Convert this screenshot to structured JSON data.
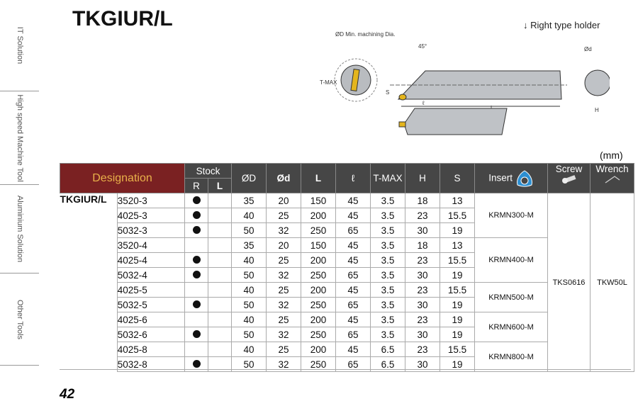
{
  "sidebar": [
    "IT Solution",
    "High speed Machine Tool",
    "Aluminium Solution",
    "Other Tools"
  ],
  "title": "TKGIUR/L",
  "right_type": "↓ Right  type holder",
  "diagram": {
    "min_dia": "ØD Min. machining Dia.",
    "angle": "45°",
    "tmax": "T-MAX",
    "s": "S",
    "l": "ℓ",
    "L": "L",
    "d": "Ød",
    "h": "H"
  },
  "unit": "(mm)",
  "headers": {
    "designation": "Designation",
    "stock": "Stock",
    "r": "R",
    "l_stock": "L",
    "D": "ØD",
    "d": "Ød",
    "L": "L",
    "ell": "ℓ",
    "tmax": "T-MAX",
    "H": "H",
    "S": "S",
    "insert": "Insert",
    "screw": "Screw",
    "wrench": "Wrench"
  },
  "model": "TKGIUR/L",
  "rows": [
    [
      "3520-3",
      true,
      false,
      "35",
      "20",
      "150",
      "45",
      "3.5",
      "18",
      "13"
    ],
    [
      "4025-3",
      true,
      false,
      "40",
      "25",
      "200",
      "45",
      "3.5",
      "23",
      "15.5"
    ],
    [
      "5032-3",
      true,
      false,
      "50",
      "32",
      "250",
      "65",
      "3.5",
      "30",
      "19"
    ],
    [
      "3520-4",
      false,
      false,
      "35",
      "20",
      "150",
      "45",
      "3.5",
      "18",
      "13"
    ],
    [
      "4025-4",
      true,
      false,
      "40",
      "25",
      "200",
      "45",
      "3.5",
      "23",
      "15.5"
    ],
    [
      "5032-4",
      true,
      false,
      "50",
      "32",
      "250",
      "65",
      "3.5",
      "30",
      "19"
    ],
    [
      "4025-5",
      false,
      false,
      "40",
      "25",
      "200",
      "45",
      "3.5",
      "23",
      "15.5"
    ],
    [
      "5032-5",
      true,
      false,
      "50",
      "32",
      "250",
      "65",
      "3.5",
      "30",
      "19"
    ],
    [
      "4025-6",
      false,
      false,
      "40",
      "25",
      "200",
      "45",
      "3.5",
      "23",
      "19"
    ],
    [
      "5032-6",
      true,
      false,
      "50",
      "32",
      "250",
      "65",
      "3.5",
      "30",
      "19"
    ],
    [
      "4025-8",
      false,
      false,
      "40",
      "25",
      "200",
      "45",
      "6.5",
      "23",
      "15.5"
    ],
    [
      "5032-8",
      true,
      false,
      "50",
      "32",
      "250",
      "65",
      "6.5",
      "30",
      "19"
    ]
  ],
  "inserts": [
    {
      "name": "KRMN300-M",
      "span": 3
    },
    {
      "name": "KRMN400-M",
      "span": 3
    },
    {
      "name": "KRMN500-M",
      "span": 2
    },
    {
      "name": "KRMN600-M",
      "span": 2
    },
    {
      "name": "KRMN800-M",
      "span": 2
    }
  ],
  "screw": "TKS0616",
  "wrench": "TKW50L",
  "page_number": "42"
}
